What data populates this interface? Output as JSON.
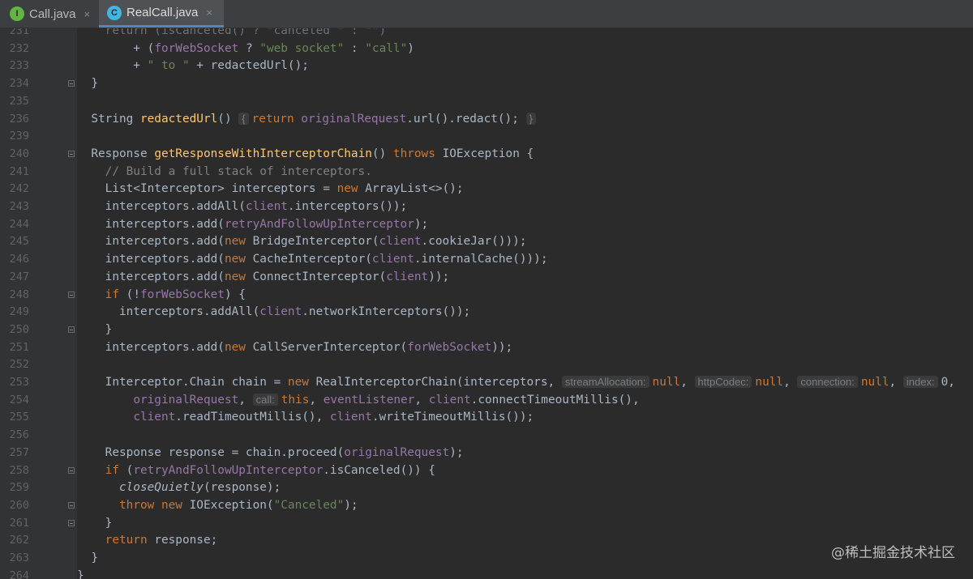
{
  "tabs": [
    {
      "label": "Call.java",
      "badge": "I"
    },
    {
      "label": "RealCall.java",
      "badge": "C",
      "active": true
    }
  ],
  "close_glyph": "×",
  "watermark": "@稀土掘金技术社区",
  "lines": [
    {
      "n": "231",
      "seg": [
        [
          "top-partial",
          "    return (isCanceled() ? \"canceled \" : \"\")"
        ]
      ]
    },
    {
      "n": "232",
      "seg": [
        [
          "",
          "        + ("
        ],
        [
          "fld",
          "forWebSocket"
        ],
        [
          "",
          " ? "
        ],
        [
          "str",
          "\"web socket\""
        ],
        [
          "",
          " : "
        ],
        [
          "str",
          "\"call\""
        ],
        [
          "",
          ")"
        ]
      ]
    },
    {
      "n": "233",
      "seg": [
        [
          "",
          "        + "
        ],
        [
          "str",
          "\" to \""
        ],
        [
          "",
          " + redactedUrl();"
        ]
      ]
    },
    {
      "n": "234",
      "seg": [
        [
          "",
          "  }"
        ]
      ]
    },
    {
      "n": "235",
      "seg": []
    },
    {
      "n": "236",
      "seg": [
        [
          "",
          "  String "
        ],
        [
          "fn",
          "redactedUrl"
        ],
        [
          "",
          "() "
        ],
        [
          "hint",
          "{"
        ],
        [
          "kw",
          "return "
        ],
        [
          "fld",
          "originalRequest"
        ],
        [
          "",
          ".url().redact(); "
        ],
        [
          "hint",
          "}"
        ]
      ]
    },
    {
      "n": "239",
      "seg": []
    },
    {
      "n": "240",
      "seg": [
        [
          "",
          "  Response "
        ],
        [
          "fn",
          "getResponseWithInterceptorChain"
        ],
        [
          "",
          "() "
        ],
        [
          "kw",
          "throws "
        ],
        [
          "",
          "IOException {"
        ]
      ]
    },
    {
      "n": "241",
      "seg": [
        [
          "cm",
          "    // Build a full stack of interceptors."
        ]
      ]
    },
    {
      "n": "242",
      "seg": [
        [
          "",
          "    List<Interceptor> interceptors = "
        ],
        [
          "kw",
          "new "
        ],
        [
          "",
          "ArrayList<>();"
        ]
      ]
    },
    {
      "n": "243",
      "seg": [
        [
          "",
          "    interceptors.addAll("
        ],
        [
          "fld",
          "client"
        ],
        [
          "",
          ".interceptors());"
        ]
      ]
    },
    {
      "n": "244",
      "seg": [
        [
          "",
          "    interceptors.add("
        ],
        [
          "fld",
          "retryAndFollowUpInterceptor"
        ],
        [
          "",
          ");"
        ]
      ]
    },
    {
      "n": "245",
      "seg": [
        [
          "",
          "    interceptors.add("
        ],
        [
          "kw",
          "new "
        ],
        [
          "",
          "BridgeInterceptor("
        ],
        [
          "fld",
          "client"
        ],
        [
          "",
          ".cookieJar()));"
        ]
      ]
    },
    {
      "n": "246",
      "seg": [
        [
          "",
          "    interceptors.add("
        ],
        [
          "kw",
          "new "
        ],
        [
          "",
          "CacheInterceptor("
        ],
        [
          "fld",
          "client"
        ],
        [
          "",
          ".internalCache()));"
        ]
      ]
    },
    {
      "n": "247",
      "seg": [
        [
          "",
          "    interceptors.add("
        ],
        [
          "kw",
          "new "
        ],
        [
          "",
          "ConnectInterceptor("
        ],
        [
          "fld",
          "client"
        ],
        [
          "",
          "));"
        ]
      ]
    },
    {
      "n": "248",
      "seg": [
        [
          "kw",
          "    if "
        ],
        [
          "",
          "(!"
        ],
        [
          "fld",
          "forWebSocket"
        ],
        [
          "",
          ") {"
        ]
      ]
    },
    {
      "n": "249",
      "seg": [
        [
          "",
          "      interceptors.addAll("
        ],
        [
          "fld",
          "client"
        ],
        [
          "",
          ".networkInterceptors());"
        ]
      ]
    },
    {
      "n": "250",
      "seg": [
        [
          "",
          "    }"
        ]
      ]
    },
    {
      "n": "251",
      "seg": [
        [
          "",
          "    interceptors.add("
        ],
        [
          "kw",
          "new "
        ],
        [
          "",
          "CallServerInterceptor("
        ],
        [
          "fld",
          "forWebSocket"
        ],
        [
          "",
          "));"
        ]
      ]
    },
    {
      "n": "252",
      "seg": []
    },
    {
      "n": "253",
      "seg": [
        [
          "",
          "    Interceptor.Chain chain = "
        ],
        [
          "kw",
          "new "
        ],
        [
          "",
          "RealInterceptorChain(interceptors, "
        ],
        [
          "hint",
          "streamAllocation:"
        ],
        [
          "kw",
          "null"
        ],
        [
          "",
          ", "
        ],
        [
          "hint",
          "httpCodec:"
        ],
        [
          "kw",
          "null"
        ],
        [
          "",
          ", "
        ],
        [
          "hint",
          "connection:"
        ],
        [
          "kw",
          "null"
        ],
        [
          "",
          ", "
        ],
        [
          "hint",
          "index:"
        ],
        [
          "",
          "0,"
        ]
      ]
    },
    {
      "n": "254",
      "seg": [
        [
          "",
          "        "
        ],
        [
          "fld",
          "originalRequest"
        ],
        [
          "",
          ", "
        ],
        [
          "hint",
          "call:"
        ],
        [
          "kw",
          "this"
        ],
        [
          "",
          ", "
        ],
        [
          "fld",
          "eventListener"
        ],
        [
          "",
          ", "
        ],
        [
          "fld",
          "client"
        ],
        [
          "",
          ".connectTimeoutMillis(),"
        ]
      ]
    },
    {
      "n": "255",
      "seg": [
        [
          "",
          "        "
        ],
        [
          "fld",
          "client"
        ],
        [
          "",
          ".readTimeoutMillis(), "
        ],
        [
          "fld",
          "client"
        ],
        [
          "",
          ".writeTimeoutMillis());"
        ]
      ]
    },
    {
      "n": "256",
      "seg": []
    },
    {
      "n": "257",
      "seg": [
        [
          "",
          "    Response response = chain.proceed("
        ],
        [
          "fld",
          "originalRequest"
        ],
        [
          "",
          ");"
        ]
      ]
    },
    {
      "n": "258",
      "seg": [
        [
          "kw",
          "    if "
        ],
        [
          "",
          "("
        ],
        [
          "fld",
          "retryAndFollowUpInterceptor"
        ],
        [
          "",
          ".isCanceled()) {"
        ]
      ]
    },
    {
      "n": "259",
      "seg": [
        [
          "",
          "      "
        ],
        [
          "it",
          "closeQuietly"
        ],
        [
          "",
          "(response);"
        ]
      ]
    },
    {
      "n": "260",
      "seg": [
        [
          "kw",
          "      throw new "
        ],
        [
          "",
          "IOException("
        ],
        [
          "str",
          "\"Canceled\""
        ],
        [
          "",
          ");"
        ]
      ]
    },
    {
      "n": "261",
      "seg": [
        [
          "",
          "    }"
        ]
      ]
    },
    {
      "n": "262",
      "seg": [
        [
          "kw",
          "    return "
        ],
        [
          "",
          "response;"
        ]
      ]
    },
    {
      "n": "263",
      "seg": [
        [
          "",
          "  }"
        ]
      ]
    },
    {
      "n": "264",
      "seg": [
        [
          "",
          "}"
        ]
      ]
    }
  ]
}
